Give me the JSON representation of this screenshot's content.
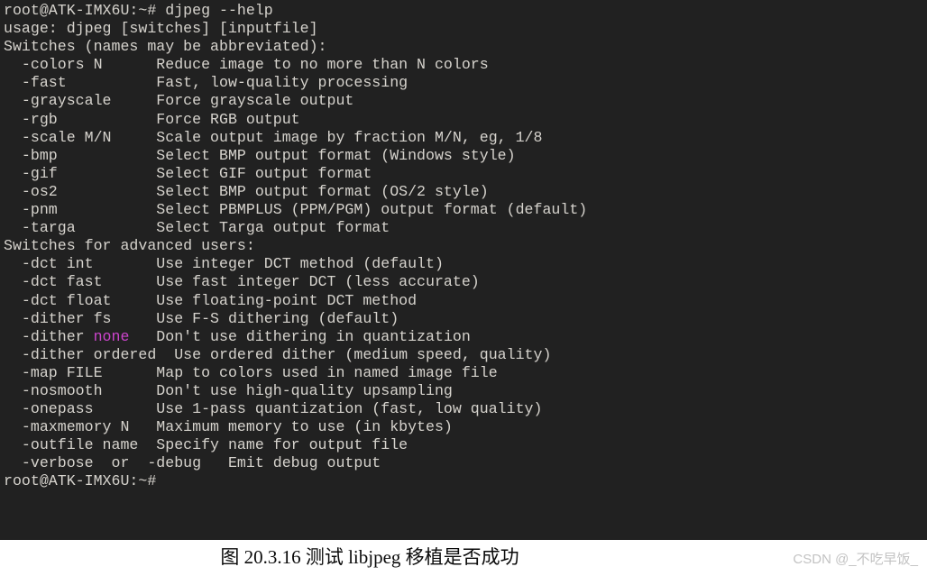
{
  "terminal": {
    "background_color": "#212121",
    "foreground_color": "#d6d3cd",
    "highlight_color": "#cc44cc",
    "prompt": "root@ATK-IMX6U:~#",
    "command": "djpeg --help",
    "lines": [
      {
        "id": "line-1",
        "text": "root@ATK-IMX6U:~# djpeg --help"
      },
      {
        "id": "line-2",
        "text": "usage: djpeg [switches] [inputfile]"
      },
      {
        "id": "line-3",
        "text": "Switches (names may be abbreviated):"
      },
      {
        "id": "line-4",
        "text": "  -colors N      Reduce image to no more than N colors"
      },
      {
        "id": "line-5",
        "text": "  -fast          Fast, low-quality processing"
      },
      {
        "id": "line-6",
        "text": "  -grayscale     Force grayscale output"
      },
      {
        "id": "line-7",
        "text": "  -rgb           Force RGB output"
      },
      {
        "id": "line-8",
        "text": "  -scale M/N     Scale output image by fraction M/N, eg, 1/8"
      },
      {
        "id": "line-9",
        "text": "  -bmp           Select BMP output format (Windows style)"
      },
      {
        "id": "line-10",
        "text": "  -gif           Select GIF output format"
      },
      {
        "id": "line-11",
        "text": "  -os2           Select BMP output format (OS/2 style)"
      },
      {
        "id": "line-12",
        "text": "  -pnm           Select PBMPLUS (PPM/PGM) output format (default)"
      },
      {
        "id": "line-13",
        "text": "  -targa         Select Targa output format"
      },
      {
        "id": "line-14",
        "text": "Switches for advanced users:"
      },
      {
        "id": "line-15",
        "text": "  -dct int       Use integer DCT method (default)"
      },
      {
        "id": "line-16",
        "text": "  -dct fast      Use fast integer DCT (less accurate)"
      },
      {
        "id": "line-17",
        "text": "  -dct float     Use floating-point DCT method"
      },
      {
        "id": "line-18",
        "text": "  -dither fs     Use F-S dithering (default)"
      },
      {
        "id": "line-19",
        "segments": [
          {
            "text": "  -dither ",
            "color": "fg"
          },
          {
            "text": "none",
            "color": "magenta"
          },
          {
            "text": "   Don't use dithering in quantization",
            "color": "fg"
          }
        ]
      },
      {
        "id": "line-20",
        "text": "  -dither ordered  Use ordered dither (medium speed, quality)"
      },
      {
        "id": "line-21",
        "text": "  -map FILE      Map to colors used in named image file"
      },
      {
        "id": "line-22",
        "text": "  -nosmooth      Don't use high-quality upsampling"
      },
      {
        "id": "line-23",
        "text": "  -onepass       Use 1-pass quantization (fast, low quality)"
      },
      {
        "id": "line-24",
        "text": "  -maxmemory N   Maximum memory to use (in kbytes)"
      },
      {
        "id": "line-25",
        "text": "  -outfile name  Specify name for output file"
      },
      {
        "id": "line-26",
        "text": "  -verbose  or  -debug   Emit debug output"
      },
      {
        "id": "line-27",
        "text": "root@ATK-IMX6U:~#"
      }
    ]
  },
  "caption": {
    "text": "图 20.3.16 测试 libjpeg 移植是否成功",
    "color": "#0a0a0a"
  },
  "watermark": {
    "text": "CSDN @_不吃早饭_",
    "color": "#c3c3c3"
  }
}
